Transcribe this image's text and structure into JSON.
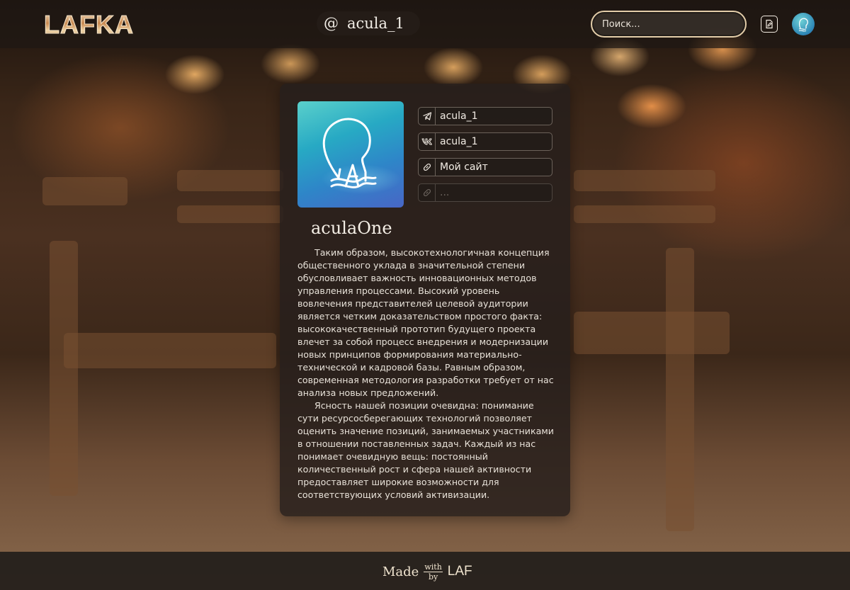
{
  "header": {
    "logo": "LAFKA",
    "handle_prefix": "@",
    "handle": "acula_1",
    "search_placeholder": "Поиск...",
    "edit_icon": "edit-document-icon",
    "avatar_icon": "user-avatar"
  },
  "profile": {
    "display_name": "aculaOne",
    "links": [
      {
        "icon": "telegram-icon",
        "text": "acula_1"
      },
      {
        "icon": "vk-icon",
        "text": "acula_1"
      },
      {
        "icon": "link-icon",
        "text": "Мой сайт"
      },
      {
        "icon": "link-icon",
        "text": "..."
      }
    ],
    "bio": [
      "Таким образом, высокотехнологичная концепция общественного уклада в значительной степени обусловливает важность инновационных методов управления процессами. Высокий уровень вовлечения представителей целевой аудитории является четким доказательством простого факта: высококачественный прототип будущего проекта влечет за собой процесс внедрения и модернизации новых принципов формирования материально-технической и кадровой базы. Равным образом, современная методология разработки требует от нас анализа новых предложений.",
      "Ясность нашей позиции очевидна: понимание сути ресурсосберегающих технологий позволяет оценить значение позиций, занимаемых участниками в отношении поставленных задач. Каждый из нас понимает очевидную вещь: постоянный количественный рост и сфера нашей активности предоставляет широкие возможности для соответствующих условий активизации."
    ]
  },
  "footer": {
    "made": "Made",
    "with": "with",
    "by": "by",
    "brand": "LAF"
  },
  "colors": {
    "accent": "#e3cda9",
    "card_bg": "#261f1c",
    "text": "#f2ece4"
  }
}
